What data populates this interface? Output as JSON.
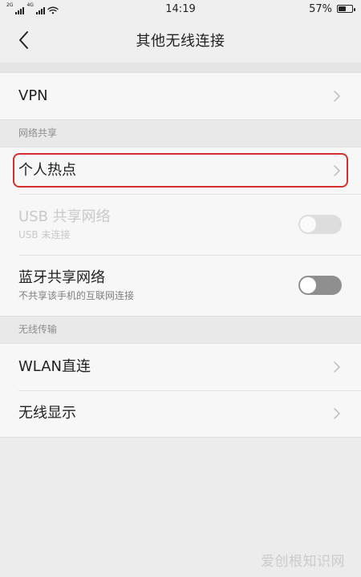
{
  "statusbar": {
    "network_left": "2G",
    "network_right": "4G",
    "time": "14:19",
    "battery_percent": "57%",
    "battery_level": 0.57
  },
  "header": {
    "title": "其他无线连接"
  },
  "items": {
    "vpn": {
      "label": "VPN"
    },
    "hotspot": {
      "label": "个人热点"
    },
    "usb_tethering": {
      "label": "USB 共享网络",
      "subtitle": "USB 未连接",
      "enabled": false,
      "on": false
    },
    "bluetooth_tethering": {
      "label": "蓝牙共享网络",
      "subtitle": "不共享该手机的互联网连接",
      "enabled": true,
      "on": false
    },
    "wlan_direct": {
      "label": "WLAN直连"
    },
    "wireless_display": {
      "label": "无线显示"
    }
  },
  "sections": {
    "network_sharing": "网络共享",
    "wireless_transfer": "无线传输"
  },
  "highlight": {
    "target": "hotspot",
    "color": "#d5302f"
  },
  "watermark": {
    "text": "爱创根知识网"
  },
  "icons": {
    "back": "back-icon",
    "chevron": "chevron-right-icon",
    "wifi": "wifi-icon",
    "signal": "signal-icon",
    "battery": "battery-icon"
  }
}
